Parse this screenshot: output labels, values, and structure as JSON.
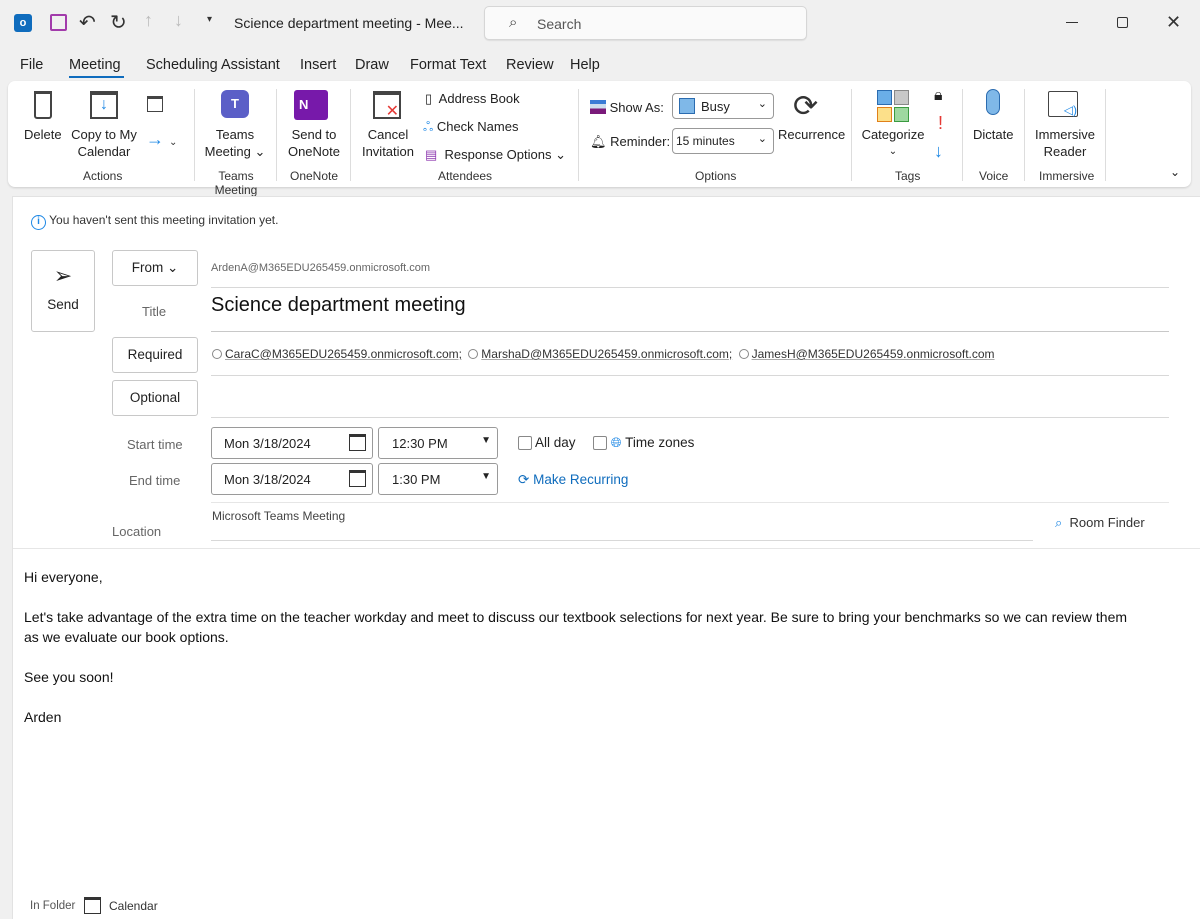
{
  "window": {
    "title": "Science department meeting  -  Mee...",
    "search_placeholder": "Search"
  },
  "menu": [
    "File",
    "Meeting",
    "Scheduling Assistant",
    "Insert",
    "Draw",
    "Format Text",
    "Review",
    "Help"
  ],
  "ribbon": {
    "delete": "Delete",
    "copy_to_my": "Copy to My",
    "calendar": "Calendar",
    "actions": "Actions",
    "teams": "Teams",
    "teams_meeting": "Meeting",
    "teams_group": "Teams Meeting",
    "send_to": "Send to",
    "onenote": "OneNote",
    "onenote_group": "OneNote",
    "cancel": "Cancel",
    "invitation": "Invitation",
    "address_book": "Address Book",
    "check_names": "Check Names",
    "response_options": "Response Options",
    "attendees": "Attendees",
    "show_as": "Show As:",
    "show_as_value": "Busy",
    "reminder": "Reminder:",
    "reminder_value": "15 minutes",
    "recurrence": "Recurrence",
    "options": "Options",
    "categorize": "Categorize",
    "tags": "Tags",
    "dictate": "Dictate",
    "voice": "Voice",
    "immersive": "Immersive",
    "reader": "Reader",
    "immersive_group": "Immersive",
    "busy_color": "#7fb8e8"
  },
  "form": {
    "info": "You haven't sent this meeting invitation yet.",
    "send": "Send",
    "from": "From",
    "from_value": "ArdenA@M365EDU265459.onmicrosoft.com",
    "title_label": "Title",
    "title_value": "Science department meeting",
    "required": "Required",
    "optional": "Optional",
    "attendees": [
      "CaraC@M365EDU265459.onmicrosoft.com;",
      "MarshaD@M365EDU265459.onmicrosoft.com;",
      "JamesH@M365EDU265459.onmicrosoft.com"
    ],
    "start_label": "Start time",
    "start_date": "Mon 3/18/2024",
    "start_time": "12:30 PM",
    "end_label": "End time",
    "end_date": "Mon 3/18/2024",
    "end_time": "1:30 PM",
    "all_day": "All day",
    "time_zones": "Time zones",
    "make_recurring": "Make Recurring",
    "location_label": "Location",
    "location_value": "Microsoft Teams Meeting",
    "room_finder": "Room Finder"
  },
  "body": [
    "Hi everyone,",
    "Let's take advantage of the extra time on the teacher workday and meet to discuss our textbook selections for next year. Be sure to bring your benchmarks so we can review them as we evaluate our book options.",
    "See you soon!",
    "Arden"
  ],
  "footer": {
    "in_folder": "In Folder",
    "folder": "Calendar"
  }
}
